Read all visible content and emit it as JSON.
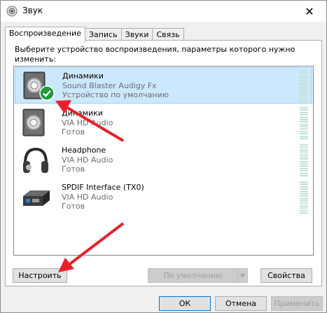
{
  "window": {
    "title": "Звук",
    "close_glyph": "✕"
  },
  "tabs": [
    {
      "label": "Воспроизведение",
      "active": true
    },
    {
      "label": "Запись",
      "active": false
    },
    {
      "label": "Звуки",
      "active": false
    },
    {
      "label": "Связь",
      "active": false
    }
  ],
  "instruction": "Выберите устройство воспроизведения, параметры которого нужно изменить:",
  "devices": [
    {
      "name": "Динамики",
      "driver": "Sound Blaster Audigy Fx",
      "status": "Устройство по умолчанию",
      "icon": "speaker-icon",
      "selected": true,
      "default_badge": "check-icon"
    },
    {
      "name": "Динамики",
      "driver": "VIA HD Audio",
      "status": "Готов",
      "icon": "speaker-icon",
      "selected": false
    },
    {
      "name": "Headphone",
      "driver": "VIA HD Audio",
      "status": "Готов",
      "icon": "headphones-icon",
      "selected": false
    },
    {
      "name": "SPDIF Interface (TX0)",
      "driver": "VIA HD Audio",
      "status": "Готов",
      "icon": "spdif-icon",
      "selected": false
    }
  ],
  "buttons": {
    "configure": "Настроить",
    "set_default": "По умолчанию",
    "properties": "Свойства",
    "ok": "ОК",
    "cancel": "Отмена",
    "apply": "Применить"
  },
  "colors": {
    "selection": "#cce8ff",
    "arrow": "#e8202a",
    "check": "#1f9b3a"
  }
}
